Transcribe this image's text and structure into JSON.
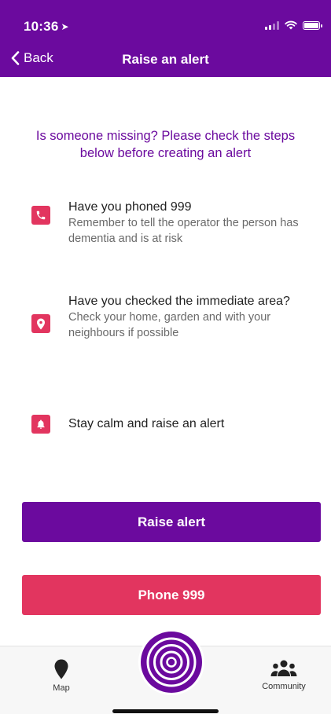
{
  "status": {
    "time": "10:36"
  },
  "nav": {
    "back_label": "Back",
    "title": "Raise an alert"
  },
  "intro": "Is someone missing? Please check the steps below before creating an alert",
  "steps": [
    {
      "icon": "phone-icon",
      "title": "Have you phoned 999",
      "description": "Remember to tell the operator the person has dementia and is at risk"
    },
    {
      "icon": "location-pin-icon",
      "title": "Have you checked the immediate area?",
      "description": "Check your home, garden and with your neighbours if possible"
    },
    {
      "icon": "bell-icon",
      "title": "Stay calm and raise an alert",
      "description": ""
    }
  ],
  "buttons": {
    "raise_alert": "Raise alert",
    "phone_999": "Phone 999"
  },
  "tabbar": {
    "map_label": "Map",
    "community_label": "Community"
  },
  "colors": {
    "brand_purple": "#6b0a9e",
    "alert_pink": "#e2355f"
  }
}
